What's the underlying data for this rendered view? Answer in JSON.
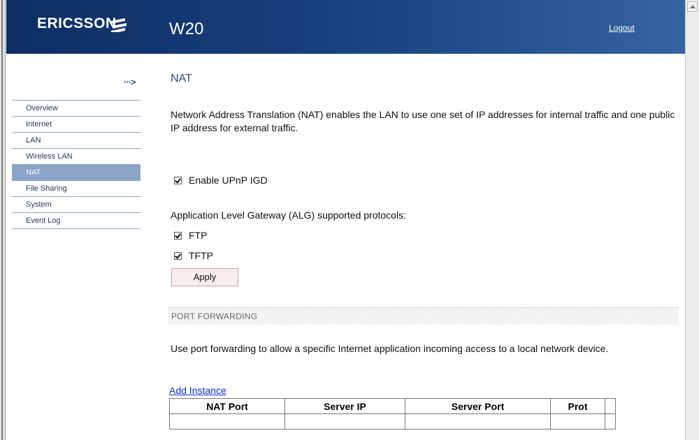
{
  "header": {
    "brand": "ERICSSON",
    "title": "W20",
    "logout_label": "Logout"
  },
  "sidebar": {
    "arrow": "···>",
    "items": [
      {
        "label": "Overview"
      },
      {
        "label": "Internet"
      },
      {
        "label": "LAN"
      },
      {
        "label": "Wireless LAN"
      },
      {
        "label": "NAT",
        "active": true
      },
      {
        "label": "File Sharing"
      },
      {
        "label": "System"
      },
      {
        "label": "Event Log"
      }
    ]
  },
  "main": {
    "title": "NAT",
    "description": "Network Address Translation (NAT) enables the LAN to use one set of IP addresses for internal traffic and one public IP address for external traffic.",
    "upnp": {
      "label": "Enable UPnP IGD",
      "checked": true
    },
    "alg_label": "Application Level Gateway (ALG) supported protocols:",
    "alg_protocols": [
      {
        "label": "FTP",
        "checked": true
      },
      {
        "label": "TFTP",
        "checked": true
      }
    ],
    "apply_label": "Apply",
    "port_forwarding": {
      "section_title": "PORT FORWARDING",
      "description": "Use port forwarding to allow a specific Internet application incoming access to a local network device.",
      "add_instance_label": "Add Instance",
      "columns": [
        "NAT Port",
        "Server IP",
        "Server Port",
        "Prot",
        ""
      ]
    }
  },
  "colors": {
    "header_dark": "#0e2e63",
    "header_light": "#35639f",
    "nav_active": "#8ca4c8",
    "link": "#0d2ecb"
  }
}
